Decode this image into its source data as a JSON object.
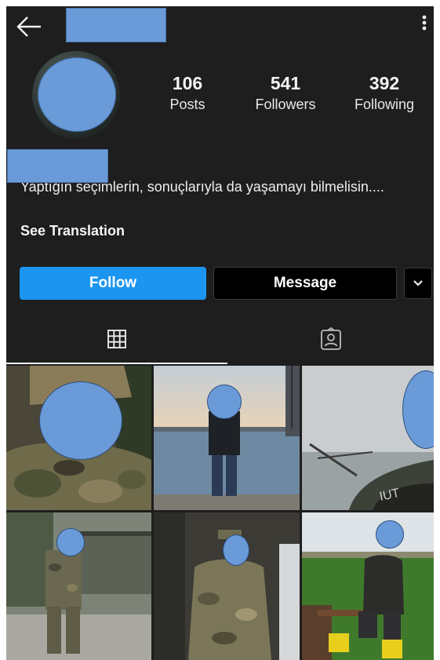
{
  "header": {
    "back_icon": "arrow-left-icon",
    "menu_icon": "more-vertical-icon"
  },
  "stats": [
    {
      "value": "106",
      "label": "Posts"
    },
    {
      "value": "541",
      "label": "Followers"
    },
    {
      "value": "392",
      "label": "Following"
    }
  ],
  "bio": {
    "text": "Yaptığın seçimlerin, sonuçlarıyla da yaşamayı bilmelisin....",
    "translate_link": "See Translation"
  },
  "actions": {
    "follow_label": "Follow",
    "message_label": "Message",
    "more_icon": "chevron-down-icon"
  },
  "tabs": [
    {
      "icon": "grid-icon",
      "selected": true
    },
    {
      "icon": "tagged-person-icon",
      "selected": false
    }
  ],
  "colors": {
    "background": "#1e1e1e",
    "follow_button": "#1c95f0",
    "redaction": "#6a9bd8"
  },
  "grid": {
    "columns": 3,
    "visible_rows": 2,
    "posts_count_visible": 6
  }
}
